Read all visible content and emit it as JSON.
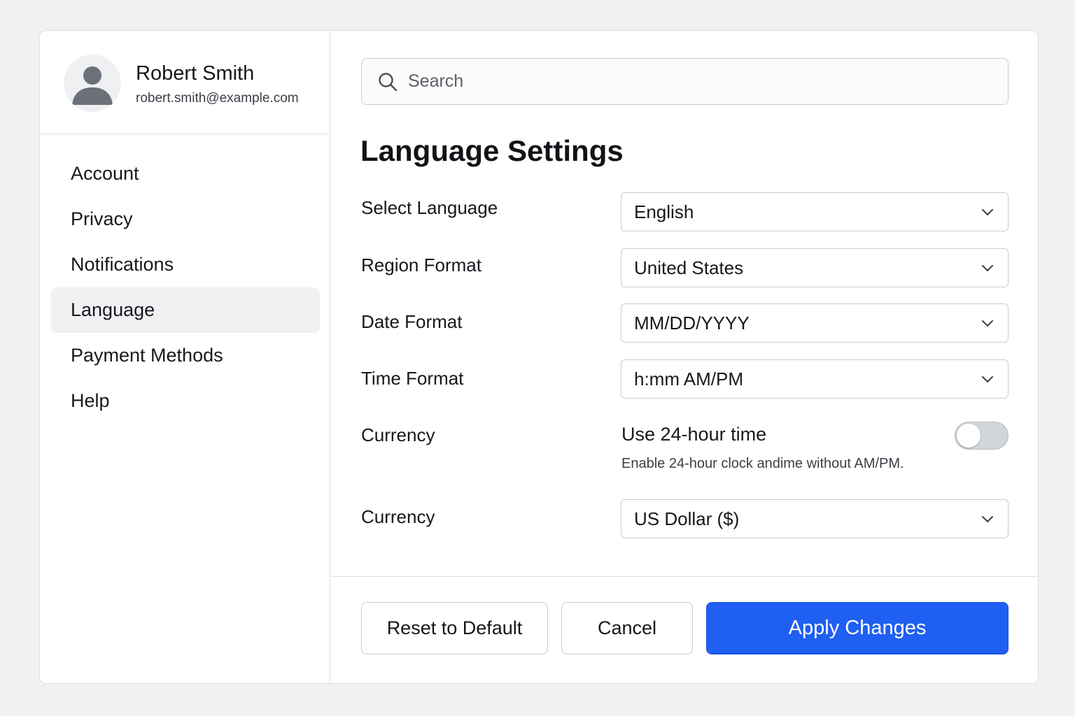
{
  "profile": {
    "name": "Robert Smith",
    "email": "robert.smith@example.com",
    "avatar_icon": "user-avatar-icon"
  },
  "sidebar": {
    "items": [
      {
        "label": "Account"
      },
      {
        "label": "Privacy"
      },
      {
        "label": "Notifications"
      },
      {
        "label": "Language",
        "active": true
      },
      {
        "label": "Payment Methods"
      },
      {
        "label": "Help"
      }
    ]
  },
  "search": {
    "placeholder": "Search",
    "value": "",
    "icon": "search-icon"
  },
  "page": {
    "title": "Language Settings"
  },
  "settings": {
    "language": {
      "label": "Select Language",
      "value": "English"
    },
    "region": {
      "label": "Region Format",
      "value": "United States"
    },
    "date": {
      "label": "Date Format",
      "value": "MM/DD/YYYY"
    },
    "time": {
      "label": "Time Format",
      "value": "h:mm AM/PM"
    },
    "toggle_row_label": "Currency",
    "toggle_24h": {
      "title": "Use 24-hour time",
      "description": "Enable 24-hour clock andime without  AM/PM.",
      "enabled": false
    },
    "currency": {
      "label": "Currency",
      "value": "US Dollar ($)"
    }
  },
  "footer": {
    "reset_label": "Reset to Default",
    "cancel_label": "Cancel",
    "apply_label": "Apply Changes"
  },
  "colors": {
    "accent": "#1f5ff1",
    "active_nav_bg": "#f0f1f3"
  }
}
